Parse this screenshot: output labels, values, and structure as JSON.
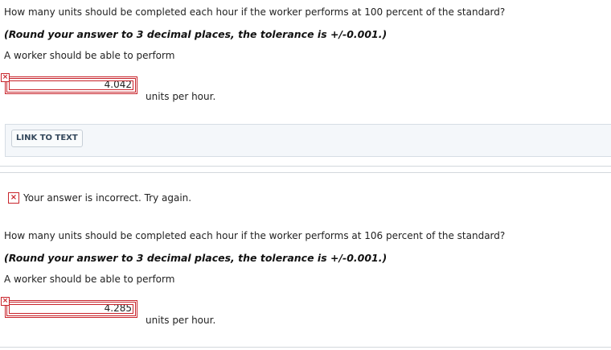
{
  "part1": {
    "question": "How many units should be completed each hour if the worker performs at 100 percent of the standard?",
    "instruction": "(Round your answer to 3 decimal places, the tolerance is +/-0.001.)",
    "prompt": "A worker should be able to perform",
    "answer_value": "4.042",
    "unit_label": "units per hour."
  },
  "link_to_text": {
    "label": "LINK TO TEXT"
  },
  "feedback": {
    "icon": "incorrect-x-icon",
    "message": "Your answer is incorrect.  Try again."
  },
  "part2": {
    "question": "How many units should be completed each hour if the worker performs at 106 percent of the standard?",
    "instruction": "(Round your answer to 3 decimal places, the tolerance is +/-0.001.)",
    "prompt": "A worker should be able to perform",
    "answer_value": "4.285",
    "unit_label": "units per hour."
  },
  "colors": {
    "error_red": "#c8242b",
    "panel_bg": "#f4f7fa"
  }
}
